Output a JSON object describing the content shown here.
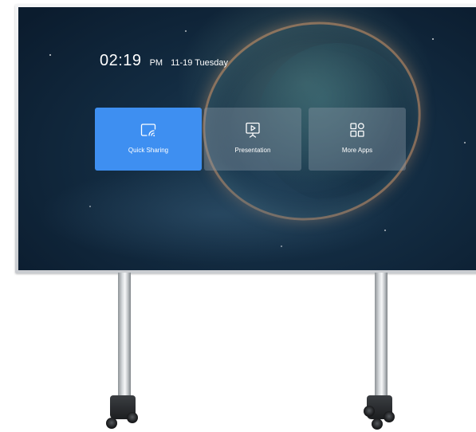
{
  "home_screen": {
    "clock": {
      "time": "02:19",
      "ampm": "PM",
      "date": "11-19 Tuesday"
    },
    "tiles": [
      {
        "label": "Quick Sharing",
        "icon": "screen-cast-icon",
        "selected": true
      },
      {
        "label": "Presentation",
        "icon": "presentation-icon",
        "selected": false
      },
      {
        "label": "More Apps",
        "icon": "app-grid-icon",
        "selected": false
      }
    ]
  },
  "colors": {
    "selected_tile": "#3e8ff1",
    "tile": "#7e8fa0",
    "text": "#ffffff"
  }
}
